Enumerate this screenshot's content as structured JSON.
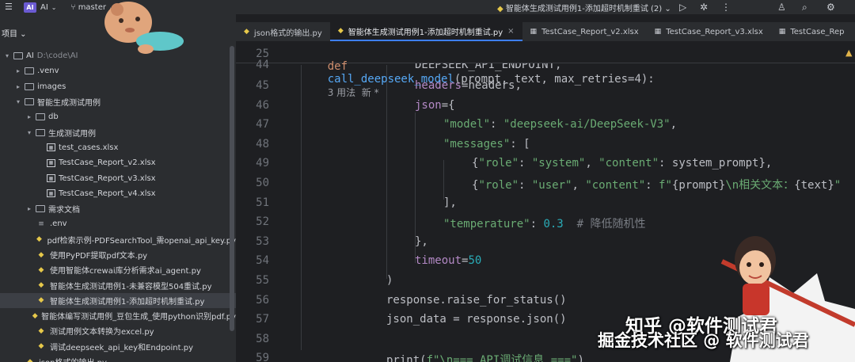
{
  "topbar": {
    "logo": "AI",
    "project": "AI",
    "branch": "master",
    "run_config": "智能体生成测试用例1-添加超时机制重试 (2)"
  },
  "sidebar": {
    "header": "项目",
    "tree": [
      {
        "indent": 0,
        "chev": "▾",
        "icon": "folder",
        "label": "AI",
        "path": "D:\\code\\AI"
      },
      {
        "indent": 1,
        "chev": "▸",
        "icon": "folder",
        "label": ".venv"
      },
      {
        "indent": 1,
        "chev": "▸",
        "icon": "folder",
        "label": "images"
      },
      {
        "indent": 1,
        "chev": "▾",
        "icon": "folder",
        "label": "智能生成测试用例"
      },
      {
        "indent": 2,
        "chev": "▸",
        "icon": "folder",
        "label": "db"
      },
      {
        "indent": 2,
        "chev": "▾",
        "icon": "folder",
        "label": "生成测试用例"
      },
      {
        "indent": 3,
        "chev": "",
        "icon": "xlsx",
        "label": "test_cases.xlsx"
      },
      {
        "indent": 3,
        "chev": "",
        "icon": "xlsx",
        "label": "TestCase_Report_v2.xlsx"
      },
      {
        "indent": 3,
        "chev": "",
        "icon": "xlsx",
        "label": "TestCase_Report_v3.xlsx"
      },
      {
        "indent": 3,
        "chev": "",
        "icon": "xlsx",
        "label": "TestCase_Report_v4.xlsx"
      },
      {
        "indent": 2,
        "chev": "▸",
        "icon": "folder",
        "label": "需求文档"
      },
      {
        "indent": 2,
        "chev": "",
        "icon": "env",
        "label": ".env"
      },
      {
        "indent": 2,
        "chev": "",
        "icon": "py",
        "label": "pdf检索示例-PDFSearchTool_需openai_api_key.py"
      },
      {
        "indent": 2,
        "chev": "",
        "icon": "py",
        "label": "使用PyPDF提取pdf文本.py"
      },
      {
        "indent": 2,
        "chev": "",
        "icon": "py",
        "label": "使用智能体crewai库分析需求ai_agent.py"
      },
      {
        "indent": 2,
        "chev": "",
        "icon": "py",
        "label": "智能体生成测试用例1-未兼容模型504重试.py"
      },
      {
        "indent": 2,
        "chev": "",
        "icon": "py",
        "label": "智能体生成测试用例1-添加超时机制重试.py",
        "selected": true
      },
      {
        "indent": 2,
        "chev": "",
        "icon": "py",
        "label": "智能体编写测试用例_豆包生成_使用python识别pdf.py"
      },
      {
        "indent": 2,
        "chev": "",
        "icon": "py",
        "label": "测试用例文本转换为excel.py"
      },
      {
        "indent": 2,
        "chev": "",
        "icon": "py",
        "label": "调试deepseek_api_key和Endpoint.py"
      },
      {
        "indent": 1,
        "chev": "",
        "icon": "py",
        "label": "json格式的输出.py"
      }
    ]
  },
  "tabs": [
    {
      "label": "json格式的输出.py",
      "icon": "py"
    },
    {
      "label": "智能体生成测试用例1-添加超时机制重试.py",
      "icon": "py",
      "active": true,
      "close": "×"
    },
    {
      "label": "TestCase_Report_v2.xlsx",
      "icon": "xlsx"
    },
    {
      "label": "TestCase_Report_v3.xlsx",
      "icon": "xlsx"
    },
    {
      "label": "TestCase_Rep",
      "icon": "xlsx"
    }
  ],
  "code": {
    "sticky": {
      "line": "25",
      "def_kw": "def",
      "fn": "call_deepseek_model",
      "args": "(prompt, text, max_retries=4):",
      "hint": "3 用法  新 *"
    },
    "partial_line": {
      "line": "44",
      "text": "DEEPSEEK_API_ENDPOINT,"
    },
    "lines": [
      {
        "n": "45",
        "indent": 4,
        "parts": [
          [
            "prm",
            "headers"
          ],
          [
            "",
            "=headers,"
          ]
        ]
      },
      {
        "n": "46",
        "indent": 4,
        "parts": [
          [
            "prm",
            "json"
          ],
          [
            "",
            "={"
          ]
        ]
      },
      {
        "n": "47",
        "indent": 5,
        "parts": [
          [
            "str",
            "\"model\""
          ],
          [
            "",
            ": "
          ],
          [
            "str",
            "\"deepseek-ai/DeepSeek-V3\""
          ],
          [
            "",
            ","
          ]
        ]
      },
      {
        "n": "48",
        "indent": 5,
        "parts": [
          [
            "str",
            "\"messages\""
          ],
          [
            "",
            ": ["
          ]
        ]
      },
      {
        "n": "49",
        "indent": 6,
        "parts": [
          [
            "",
            "{"
          ],
          [
            "str",
            "\"role\""
          ],
          [
            "",
            ": "
          ],
          [
            "str",
            "\"system\""
          ],
          [
            "",
            ", "
          ],
          [
            "str",
            "\"content\""
          ],
          [
            "",
            ": system_prompt},"
          ]
        ]
      },
      {
        "n": "50",
        "indent": 6,
        "parts": [
          [
            "",
            "{"
          ],
          [
            "str",
            "\"role\""
          ],
          [
            "",
            ": "
          ],
          [
            "str",
            "\"user\""
          ],
          [
            "",
            ", "
          ],
          [
            "str",
            "\"content\""
          ],
          [
            "",
            ": "
          ],
          [
            "str",
            "f\""
          ],
          [
            "",
            "{prompt}"
          ],
          [
            "str",
            "\\n相关文本："
          ],
          [
            "",
            "{text}"
          ],
          [
            "str",
            "\""
          ]
        ]
      },
      {
        "n": "51",
        "indent": 5,
        "parts": [
          [
            "",
            "],"
          ]
        ]
      },
      {
        "n": "52",
        "indent": 5,
        "parts": [
          [
            "str",
            "\"temperature\""
          ],
          [
            "",
            ": "
          ],
          [
            "num",
            "0.3"
          ],
          [
            "",
            "  "
          ],
          [
            "cmt",
            "# 降低随机性"
          ]
        ]
      },
      {
        "n": "53",
        "indent": 4,
        "parts": [
          [
            "",
            "},"
          ]
        ]
      },
      {
        "n": "54",
        "indent": 4,
        "parts": [
          [
            "prm",
            "timeout"
          ],
          [
            "",
            "="
          ],
          [
            "num",
            "50"
          ]
        ]
      },
      {
        "n": "55",
        "indent": 3,
        "parts": [
          [
            "",
            ")"
          ]
        ]
      },
      {
        "n": "56",
        "indent": 3,
        "parts": [
          [
            "",
            "response.raise_for_status()"
          ]
        ]
      },
      {
        "n": "57",
        "indent": 3,
        "parts": [
          [
            "",
            "json_data = response.json()"
          ]
        ]
      },
      {
        "n": "58",
        "indent": 0,
        "parts": []
      },
      {
        "n": "59",
        "indent": 3,
        "parts": [
          [
            "",
            "print("
          ],
          [
            "str",
            "f\"\\n=== API调试信息 ===\""
          ],
          [
            "",
            ")"
          ]
        ]
      }
    ]
  },
  "watermarks": {
    "zhihu": "知乎 @软件测试君",
    "juejin": "掘金技术社区 @ 软件测试君"
  },
  "colors": {
    "accent": "#3d7ef5",
    "editor_bg": "#1e1f22",
    "panel_bg": "#2b2d30"
  }
}
